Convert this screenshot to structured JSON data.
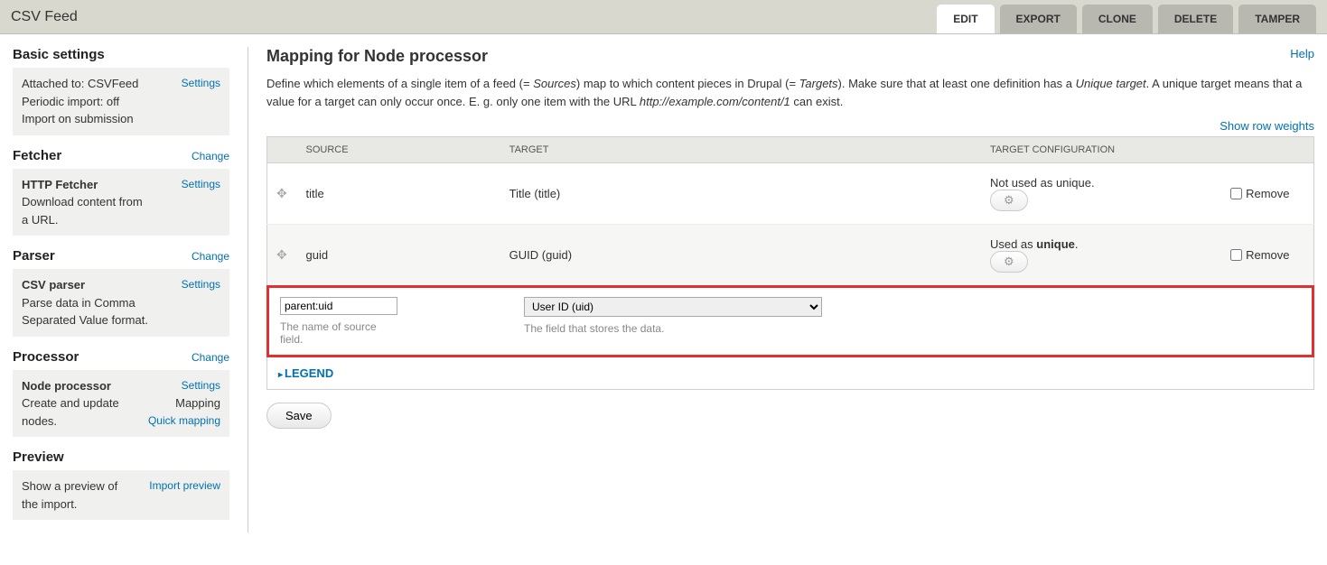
{
  "header": {
    "title": "CSV Feed",
    "tabs": [
      "EDIT",
      "EXPORT",
      "CLONE",
      "DELETE",
      "TAMPER"
    ],
    "active_tab": 0
  },
  "sidebar": {
    "basic": {
      "title": "Basic settings",
      "attached": "Attached to: CSVFeed",
      "periodic": "Periodic import: off",
      "import": "Import on submission",
      "settings": "Settings"
    },
    "fetcher": {
      "title": "Fetcher",
      "change": "Change",
      "name": "HTTP Fetcher",
      "desc": "Download content from a URL.",
      "settings": "Settings"
    },
    "parser": {
      "title": "Parser",
      "change": "Change",
      "name": "CSV parser",
      "desc": "Parse data in Comma Separated Value format.",
      "settings": "Settings"
    },
    "processor": {
      "title": "Processor",
      "change": "Change",
      "name": "Node processor",
      "desc": "Create and update nodes.",
      "settings": "Settings",
      "mapping": "Mapping",
      "quick": "Quick mapping"
    },
    "preview": {
      "title": "Preview",
      "desc": "Show a preview of the import.",
      "link": "Import preview"
    }
  },
  "main": {
    "title": "Mapping for Node processor",
    "help": "Help",
    "desc_1": "Define which elements of a single item of a feed (= ",
    "desc_sources": "Sources",
    "desc_2": ") map to which content pieces in Drupal (= ",
    "desc_targets": "Targets",
    "desc_3": "). Make sure that at least one definition has a ",
    "desc_unique": "Unique target",
    "desc_4": ". A unique target means that a value for a target can only occur once. E. g. only one item with the URL ",
    "desc_url": "http://example.com/content/1",
    "desc_5": " can exist.",
    "rowweights": "Show row weights",
    "columns": {
      "source": "SOURCE",
      "target": "TARGET",
      "config": "TARGET CONFIGURATION",
      "remove_h": ""
    },
    "rows": [
      {
        "source": "title",
        "target": "Title (title)",
        "config": "Not used as unique.",
        "remove": "Remove"
      },
      {
        "source": "guid",
        "target": "GUID (guid)",
        "config_pre": "Used as ",
        "config_bold": "unique",
        "config_post": ".",
        "remove": "Remove"
      }
    ],
    "add": {
      "source_value": "parent:uid",
      "source_help": "The name of source field.",
      "target_value": "User ID (uid)",
      "target_help": "The field that stores the data."
    },
    "legend": "LEGEND",
    "save": "Save"
  }
}
